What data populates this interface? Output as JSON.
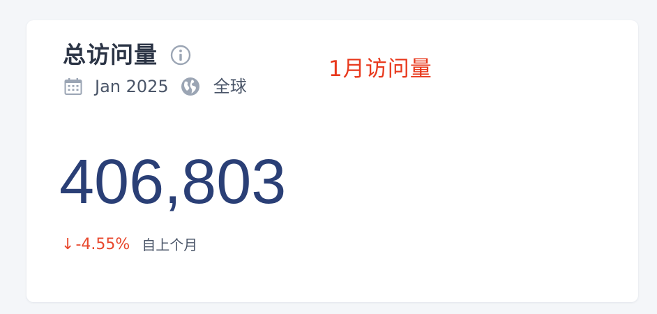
{
  "card": {
    "title": "总访问量",
    "annotation": "1月访问量",
    "date": "Jan 2025",
    "region": "全球",
    "value": "406,803",
    "change": {
      "arrow": "↓",
      "value": "-4.55%",
      "label": "自上个月"
    },
    "icons": {
      "info": "info-icon",
      "calendar": "calendar-icon",
      "globe": "globe-icon"
    }
  },
  "colors": {
    "page_background": "#f4f6f9",
    "card_background": "#ffffff",
    "title": "#2b3445",
    "annotation": "#e8391d",
    "meta_text": "#4a5568",
    "icon_gray": "#9ba5b4",
    "big_number": "#2a3f76",
    "negative_change": "#e8472c"
  }
}
